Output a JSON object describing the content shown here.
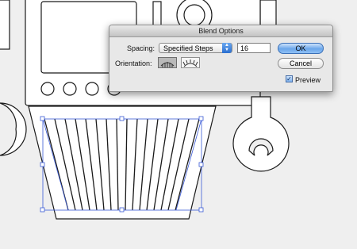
{
  "dialog": {
    "title": "Blend Options",
    "spacing_label": "Spacing:",
    "spacing_value": "Specified Steps",
    "steps_value": "16",
    "orientation_label": "Orientation:",
    "ok_label": "OK",
    "cancel_label": "Cancel",
    "preview_label": "Preview",
    "preview_checked": true
  },
  "colors": {
    "canvas_background": "#efefef",
    "selection_color": "#3b5bd6",
    "artwork_stroke": "#1a1a1a"
  }
}
